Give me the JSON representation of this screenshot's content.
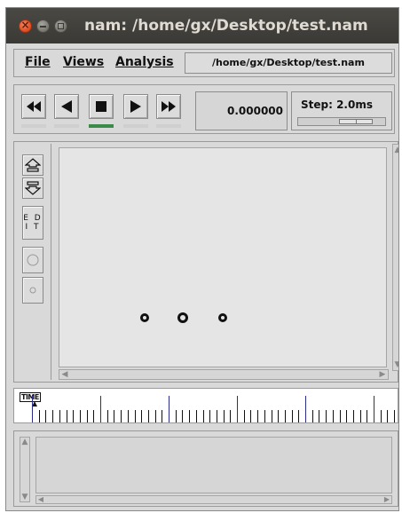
{
  "window": {
    "title": "nam: /home/gx/Desktop/test.nam"
  },
  "menu": {
    "file": "File",
    "views": "Views",
    "analysis": "Analysis",
    "path": "/home/gx/Desktop/test.nam"
  },
  "controls": {
    "buttons": [
      "fast-rewind-icon",
      "play-backward-icon",
      "stop-icon",
      "play-forward-icon",
      "fast-forward-icon"
    ],
    "active_button": "stop",
    "time": "0.000000",
    "step_label": "Step: 2.0ms"
  },
  "tools": {
    "edit_line1": "E D",
    "edit_line2": "I T"
  },
  "timeline": {
    "label": "TIME"
  },
  "colors": {
    "active_indicator": "#3b8a4a",
    "timeline_major_tick": "#2c2c8a",
    "titlebar": "#3c3b37",
    "close_button": "#df4a1e"
  }
}
